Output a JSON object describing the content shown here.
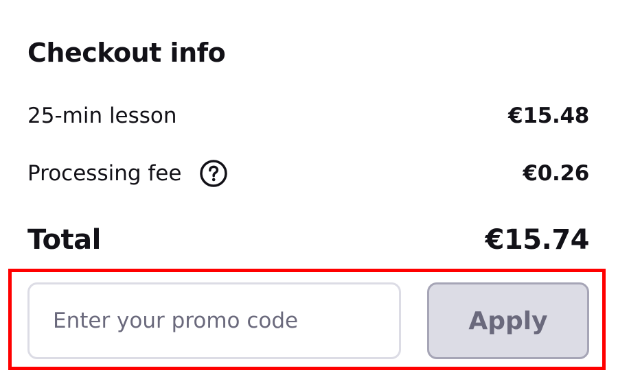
{
  "checkout": {
    "title": "Checkout info",
    "lesson": {
      "label": "25-min lesson",
      "value": "€15.48"
    },
    "fee": {
      "label": "Processing fee",
      "value": "€0.26",
      "icon": "question-circle-icon"
    },
    "total": {
      "label": "Total",
      "value": "€15.74"
    }
  },
  "promo": {
    "placeholder": "Enter your promo code",
    "value": "",
    "apply_label": "Apply"
  },
  "colors": {
    "text": "#121117",
    "highlight": "#ff0000",
    "input_border": "#dcdce5",
    "button_bg": "#dcdce5",
    "button_border": "#a6a5b6",
    "button_text": "#6a697c"
  }
}
